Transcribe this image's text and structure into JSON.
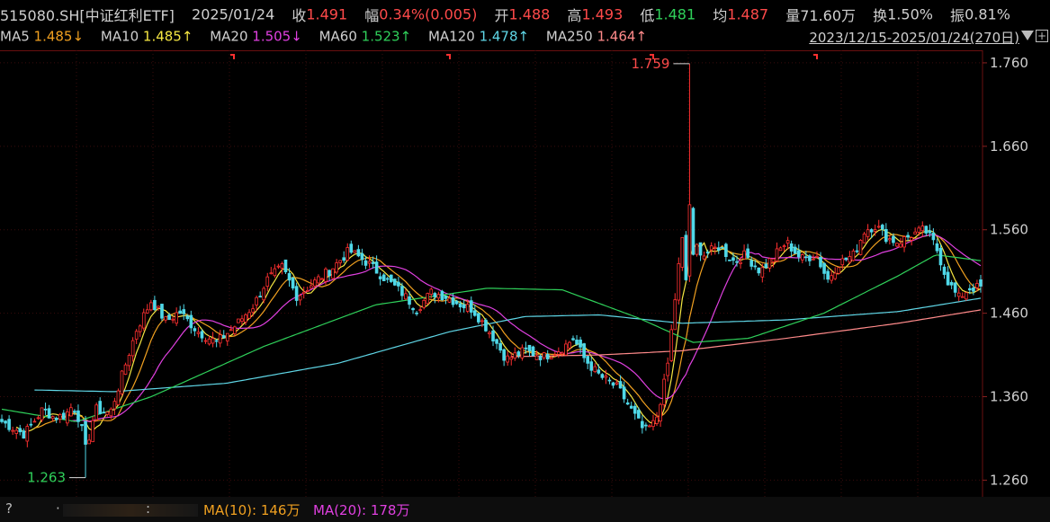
{
  "header": {
    "code": "515080.SH[中证红利ETF]",
    "date": "2025/01/24",
    "close_label": "收",
    "close": "1.491",
    "change_label": "幅",
    "change": "0.34%(0.005)",
    "open_label": "开",
    "open": "1.488",
    "high_label": "高",
    "high": "1.493",
    "low_label": "低",
    "low": "1.481",
    "avg_label": "均",
    "avg": "1.487",
    "volume_label": "量",
    "volume": "71.60万",
    "turnover_label": "换",
    "turnover": "1.50%",
    "amp_label": "振",
    "amp": "0.81%"
  },
  "ma_bar": [
    {
      "label": "MA5",
      "value": "1.485↓",
      "color": "#f0a020"
    },
    {
      "label": "MA10",
      "value": "1.485↑",
      "color": "#f5e642"
    },
    {
      "label": "MA20",
      "value": "1.505↓",
      "color": "#e040e0"
    },
    {
      "label": "MA60",
      "value": "1.523↑",
      "color": "#2fd05a"
    },
    {
      "label": "MA120",
      "value": "1.478↑",
      "color": "#5fd6e6"
    },
    {
      "label": "MA250",
      "value": "1.464↑",
      "color": "#ff8a8a"
    }
  ],
  "range_label": "2023/12/15-2025/01/24(270日)",
  "bottom": {
    "question": "?",
    "dot1": "·",
    "dot2": ":",
    "vma10": "MA(10): 146万",
    "vma20": "MA(20): 178万"
  },
  "chart_data": {
    "type": "candlestick",
    "ylim": [
      1.24,
      1.775
    ],
    "yticks": [
      "1.760",
      "1.660",
      "1.560",
      "1.460",
      "1.360",
      "1.260"
    ],
    "annotations": {
      "high": "1.759",
      "low": "1.263"
    },
    "count": 270,
    "close_anchors": [
      [
        0,
        1.33
      ],
      [
        12,
        1.315
      ],
      [
        22,
        1.345
      ],
      [
        28,
        1.335
      ],
      [
        34,
        1.338
      ],
      [
        38,
        1.35
      ],
      [
        42,
        1.33
      ],
      [
        45,
        1.295
      ],
      [
        50,
        1.345
      ],
      [
        58,
        1.34
      ],
      [
        65,
        1.39
      ],
      [
        72,
        1.44
      ],
      [
        80,
        1.475
      ],
      [
        88,
        1.45
      ],
      [
        95,
        1.462
      ],
      [
        105,
        1.438
      ],
      [
        115,
        1.425
      ],
      [
        125,
        1.445
      ],
      [
        135,
        1.47
      ],
      [
        142,
        1.5
      ],
      [
        150,
        1.515
      ],
      [
        158,
        1.48
      ],
      [
        166,
        1.495
      ],
      [
        176,
        1.512
      ],
      [
        186,
        1.535
      ],
      [
        196,
        1.52
      ],
      [
        206,
        1.5
      ],
      [
        214,
        1.485
      ],
      [
        222,
        1.465
      ],
      [
        230,
        1.485
      ],
      [
        238,
        1.48
      ],
      [
        246,
        1.47
      ],
      [
        252,
        1.465
      ],
      [
        262,
        1.435
      ],
      [
        270,
        1.405
      ],
      [
        280,
        1.415
      ],
      [
        290,
        1.408
      ],
      [
        300,
        1.418
      ],
      [
        306,
        1.43
      ],
      [
        312,
        1.405
      ],
      [
        320,
        1.385
      ],
      [
        330,
        1.37
      ],
      [
        338,
        1.34
      ],
      [
        344,
        1.318
      ],
      [
        350,
        1.33
      ],
      [
        356,
        1.39
      ],
      [
        360,
        1.47
      ],
      [
        364,
        1.55
      ],
      [
        368,
        1.51
      ],
      [
        372,
        1.54
      ],
      [
        376,
        1.53
      ],
      [
        384,
        1.54
      ],
      [
        392,
        1.522
      ],
      [
        398,
        1.53
      ],
      [
        406,
        1.51
      ],
      [
        414,
        1.53
      ],
      [
        420,
        1.545
      ],
      [
        428,
        1.525
      ],
      [
        436,
        1.53
      ],
      [
        442,
        1.5
      ],
      [
        448,
        1.52
      ],
      [
        456,
        1.53
      ],
      [
        462,
        1.56
      ],
      [
        468,
        1.565
      ],
      [
        474,
        1.55
      ],
      [
        480,
        1.545
      ],
      [
        488,
        1.555
      ],
      [
        494,
        1.56
      ],
      [
        500,
        1.54
      ],
      [
        506,
        1.5
      ],
      [
        512,
        1.478
      ],
      [
        518,
        1.49
      ],
      [
        524,
        1.491
      ]
    ],
    "ma_series": [
      {
        "name": "MA120",
        "color": "#5fd6e6",
        "start": 18,
        "anchors": [
          [
            18,
            1.368
          ],
          [
            60,
            1.366
          ],
          [
            120,
            1.376
          ],
          [
            180,
            1.4
          ],
          [
            240,
            1.438
          ],
          [
            280,
            1.456
          ],
          [
            320,
            1.458
          ],
          [
            364,
            1.448
          ],
          [
            420,
            1.452
          ],
          [
            480,
            1.462
          ],
          [
            524,
            1.478
          ]
        ]
      },
      {
        "name": "MA250",
        "color": "#ff8a8a",
        "start": 273,
        "anchors": [
          [
            273,
            1.408
          ],
          [
            320,
            1.41
          ],
          [
            364,
            1.415
          ],
          [
            420,
            1.43
          ],
          [
            480,
            1.448
          ],
          [
            524,
            1.464
          ]
        ]
      },
      {
        "name": "MA60",
        "color": "#2fd05a",
        "start": 0,
        "anchors": [
          [
            0,
            1.345
          ],
          [
            40,
            1.33
          ],
          [
            80,
            1.36
          ],
          [
            140,
            1.42
          ],
          [
            200,
            1.47
          ],
          [
            260,
            1.49
          ],
          [
            300,
            1.488
          ],
          [
            340,
            1.455
          ],
          [
            370,
            1.425
          ],
          [
            400,
            1.43
          ],
          [
            440,
            1.46
          ],
          [
            480,
            1.505
          ],
          [
            500,
            1.53
          ],
          [
            524,
            1.523
          ]
        ]
      }
    ]
  }
}
